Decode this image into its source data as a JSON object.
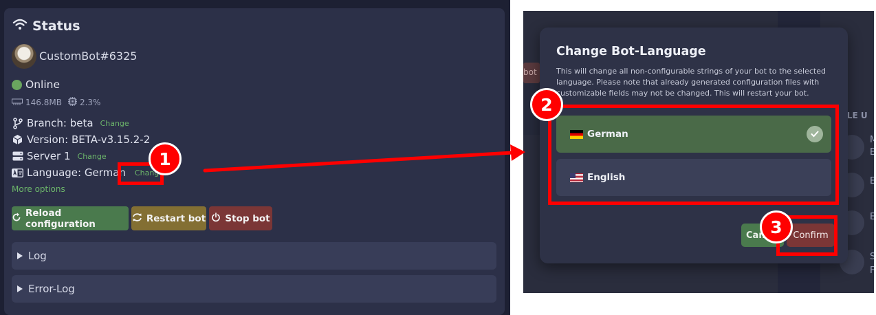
{
  "status": {
    "title": "Status",
    "bot_name": "CustomBot#6325",
    "online_text": "Online",
    "memory": "146.8MB",
    "cpu": "2.3%",
    "branch": "Branch: beta",
    "branch_change": "Change",
    "version": "Version: BETA-v3.15.2-2",
    "server": "Server 1",
    "server_change": "Change",
    "language": "Language: German",
    "language_change": "Change",
    "more_options": "More options",
    "buttons": {
      "reload": "Reload configuration",
      "restart": "Restart bot",
      "stop": "Stop bot"
    },
    "collapsibles": {
      "log": "Log",
      "error_log": "Error-Log"
    }
  },
  "background": {
    "bot_fragment": "bot",
    "people_fragment": "PLE U",
    "letters": [
      "M",
      "E",
      "E",
      "E",
      "S",
      "F"
    ]
  },
  "modal": {
    "title": "Change Bot-Language",
    "description": "This will change all non-configurable strings of your bot to the selected language. Please note that already generated configuration files with customizable fields may not be changed. This will restart your bot.",
    "options": [
      {
        "label": "German",
        "flag": "de",
        "selected": true
      },
      {
        "label": "English",
        "flag": "us",
        "selected": false
      }
    ],
    "cancel_label": "Canc",
    "confirm_label": "Confirm"
  },
  "annotations": {
    "step1": "1",
    "step2": "2",
    "step3": "3",
    "color": "#ff0000"
  },
  "colors": {
    "online": "#6aa55f",
    "link": "#6cb56a",
    "reload_btn": "#4a7a4d",
    "restart_btn": "#836f33",
    "stop_btn": "#7b3636",
    "selected_option": "#4a6a48"
  }
}
